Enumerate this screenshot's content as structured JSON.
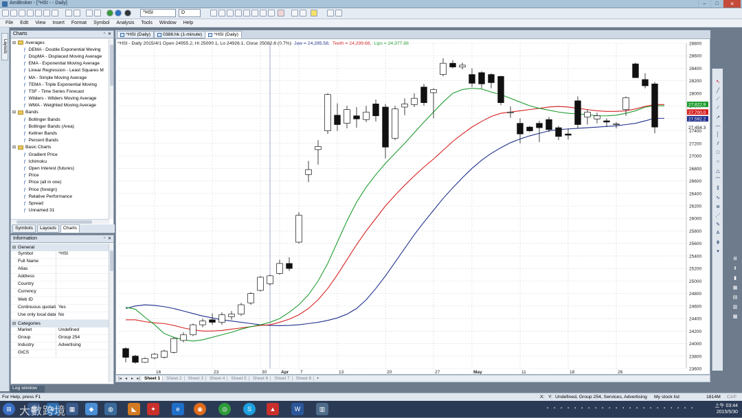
{
  "window": {
    "title": "AmiBroker - [^HSI - - Daily]",
    "min": "–",
    "max": "□",
    "close": "✕"
  },
  "toolbar": {
    "symbol": "^HSI",
    "interval": "D"
  },
  "menu": [
    "File",
    "Edit",
    "View",
    "Insert",
    "Format",
    "Symbol",
    "Analysis",
    "Tools",
    "Window",
    "Help"
  ],
  "left_tab": "Layouts",
  "charts_panel": {
    "title": "Charts",
    "tree": [
      {
        "kind": "folder",
        "label": "Averages"
      },
      {
        "kind": "item",
        "label": "DEMA - Double Exponential Moving"
      },
      {
        "kind": "item",
        "label": "DispMA - Displaced Moving Average"
      },
      {
        "kind": "item",
        "label": "EMA - Exponential Moving Average"
      },
      {
        "kind": "item",
        "label": "Linear Regression - Least Squares M"
      },
      {
        "kind": "item",
        "label": "MA - Simple Moving Average"
      },
      {
        "kind": "item",
        "label": "TEMA - Triple Exponential Moving"
      },
      {
        "kind": "item",
        "label": "TSF - Time Series Forecast"
      },
      {
        "kind": "item",
        "label": "Wilders - Wilders Moving Average"
      },
      {
        "kind": "item",
        "label": "WMA - Weighted Moving Average"
      },
      {
        "kind": "folder",
        "label": "Bands"
      },
      {
        "kind": "item",
        "label": "Bollinger Bands"
      },
      {
        "kind": "item",
        "label": "Bollinger Bands (Area)"
      },
      {
        "kind": "item",
        "label": "Keltner Bands"
      },
      {
        "kind": "item",
        "label": "Percent Bands"
      },
      {
        "kind": "folder",
        "label": "Basic Charts"
      },
      {
        "kind": "item",
        "label": "Gradient Price"
      },
      {
        "kind": "item",
        "label": "Ichimoku"
      },
      {
        "kind": "item",
        "label": "Open Interest (futures)"
      },
      {
        "kind": "item",
        "label": "Price"
      },
      {
        "kind": "item",
        "label": "Price (all in one)"
      },
      {
        "kind": "item",
        "label": "Price (foreign)"
      },
      {
        "kind": "item",
        "label": "Relative Performance"
      },
      {
        "kind": "item",
        "label": "Spread"
      },
      {
        "kind": "item",
        "label": "Unnamed 31"
      }
    ],
    "tabs": [
      "Symbols",
      "Layouts",
      "Charts"
    ],
    "active_tab": "Charts"
  },
  "info_panel": {
    "title": "Information",
    "sections": [
      {
        "name": "General",
        "rows": [
          {
            "k": "Symbol",
            "v": "^HSI"
          },
          {
            "k": "Full Name",
            "v": ""
          },
          {
            "k": "Alias",
            "v": ""
          },
          {
            "k": "Address",
            "v": ""
          },
          {
            "k": "Country",
            "v": ""
          },
          {
            "k": "Currency",
            "v": ""
          },
          {
            "k": "Web ID",
            "v": ""
          },
          {
            "k": "Continuous quotatio",
            "v": "Yes"
          },
          {
            "k": "Use only local datab",
            "v": "No"
          }
        ]
      },
      {
        "name": "Categories",
        "rows": [
          {
            "k": "Market",
            "v": "Undefined"
          },
          {
            "k": "Group",
            "v": "Group 254"
          },
          {
            "k": "Industry",
            "v": "Advertising"
          },
          {
            "k": "GICS",
            "v": ""
          }
        ]
      }
    ]
  },
  "doc_tabs": [
    "^HSI (Daily)",
    "0388.hk (1-minute)",
    "^HSI (Daily)"
  ],
  "active_doc_tab": 2,
  "chart_header": {
    "prefix": "^HSI - Daily 2015/4/1 Open 24955.2, Hi 25099.1, Lo 24926.1, Close 25082.8 (0.7%)",
    "jaw": "Jaw = 24,285.58,",
    "teeth": "Teeth = 24,299.68,",
    "lips": "Lips = 24,377.88"
  },
  "chart_data": {
    "type": "candlestick",
    "title": "^HSI - Daily",
    "ylim": [
      23600,
      28800
    ],
    "yticks": [
      23600,
      23800,
      24000,
      24200,
      24400,
      24600,
      24800,
      25000,
      25200,
      25400,
      25600,
      25800,
      26000,
      26200,
      26400,
      26600,
      26800,
      27000,
      27200,
      27400,
      27600,
      27800,
      28000,
      28200,
      28400,
      28600,
      28800
    ],
    "xlabels": [
      {
        "i": 3,
        "label": "16"
      },
      {
        "i": 9,
        "label": "23"
      },
      {
        "i": 14,
        "label": "30"
      },
      {
        "i": 16,
        "label": "Apr"
      },
      {
        "i": 18,
        "label": "7"
      },
      {
        "i": 22,
        "label": "13"
      },
      {
        "i": 27,
        "label": "20"
      },
      {
        "i": 32,
        "label": "27"
      },
      {
        "i": 36,
        "label": "May"
      },
      {
        "i": 41,
        "label": "11"
      },
      {
        "i": 46,
        "label": "18"
      },
      {
        "i": 51,
        "label": "26"
      }
    ],
    "ohlc": [
      [
        23920,
        23940,
        23700,
        23780
      ],
      [
        23800,
        23820,
        23680,
        23700
      ],
      [
        23700,
        23780,
        23690,
        23760
      ],
      [
        23770,
        23850,
        23750,
        23830
      ],
      [
        23780,
        23900,
        23760,
        23880
      ],
      [
        23860,
        24100,
        23840,
        24080
      ],
      [
        24050,
        24180,
        24020,
        24140
      ],
      [
        24140,
        24320,
        24120,
        24300
      ],
      [
        24300,
        24400,
        24260,
        24360
      ],
      [
        24380,
        24480,
        24300,
        24340
      ],
      [
        24340,
        24500,
        24300,
        24460
      ],
      [
        24430,
        24520,
        24380,
        24470
      ],
      [
        24470,
        24650,
        24440,
        24620
      ],
      [
        24650,
        24820,
        24620,
        24800
      ],
      [
        24850,
        25080,
        24830,
        25060
      ],
      [
        24955,
        25099,
        24926,
        25083
      ],
      [
        25120,
        25340,
        25100,
        25280
      ],
      [
        25280,
        25380,
        25160,
        25200
      ],
      [
        25620,
        26100,
        25600,
        26050
      ],
      [
        26700,
        26920,
        26580,
        26780
      ],
      [
        27100,
        27250,
        26860,
        27150
      ],
      [
        27400,
        28000,
        27350,
        27980
      ],
      [
        27650,
        27840,
        27400,
        27500
      ],
      [
        27520,
        27800,
        27440,
        27740
      ],
      [
        27640,
        27780,
        27450,
        27590
      ],
      [
        27580,
        27800,
        27540,
        27700
      ],
      [
        27830,
        27900,
        27550,
        27640
      ],
      [
        27780,
        27830,
        26960,
        27140
      ],
      [
        27280,
        27800,
        27250,
        27750
      ],
      [
        27780,
        27920,
        27650,
        27830
      ],
      [
        27820,
        28000,
        27780,
        27920
      ],
      [
        28100,
        28150,
        27800,
        27850
      ],
      [
        28010,
        28080,
        27600,
        28060
      ],
      [
        28300,
        28560,
        28270,
        28480
      ],
      [
        28480,
        28530,
        28400,
        28420
      ],
      [
        28420,
        28490,
        28380,
        28450
      ],
      [
        28300,
        28400,
        28100,
        28160
      ],
      [
        28330,
        28350,
        28080,
        28150
      ],
      [
        28300,
        28320,
        28080,
        28170
      ],
      [
        28270,
        28280,
        27810,
        27850
      ],
      [
        27690,
        27790,
        27610,
        27700
      ],
      [
        27520,
        27600,
        27200,
        27350
      ],
      [
        27460,
        27480,
        27380,
        27400
      ],
      [
        27520,
        27560,
        27220,
        27450
      ],
      [
        27580,
        27620,
        27380,
        27420
      ],
      [
        27450,
        27480,
        27250,
        27310
      ],
      [
        27350,
        27440,
        27260,
        27330
      ],
      [
        27880,
        27950,
        27440,
        27500
      ],
      [
        27620,
        27740,
        27500,
        27700
      ],
      [
        27590,
        27690,
        27520,
        27640
      ],
      [
        27560,
        27600,
        27460,
        27540
      ],
      [
        27500,
        27540,
        27440,
        27510
      ],
      [
        27740,
        27950,
        27640,
        27930
      ],
      [
        28470,
        28490,
        28260,
        28250
      ],
      [
        28220,
        28320,
        28080,
        28120
      ],
      [
        28150,
        28180,
        27360,
        27460
      ]
    ],
    "series": [
      {
        "name": "Jaw",
        "color": "#1f2f8c",
        "values": [
          24560,
          24600,
          24620,
          24610,
          24590,
          24560,
          24520,
          24480,
          24440,
          24410,
          24380,
          24360,
          24340,
          24320,
          24300,
          24290,
          24286,
          24290,
          24300,
          24320,
          24340,
          24370,
          24410,
          24470,
          24560,
          24700,
          24880,
          25080,
          25300,
          25520,
          25740,
          25940,
          26130,
          26320,
          26490,
          26650,
          26800,
          26930,
          27040,
          27130,
          27210,
          27270,
          27320,
          27360,
          27400,
          27420,
          27430,
          27440,
          27450,
          27460,
          27470,
          27480,
          27500,
          27520,
          27560,
          27600,
          27600
        ]
      },
      {
        "name": "Teeth",
        "color": "#d62020",
        "values": [
          24380,
          24380,
          24350,
          24330,
          24320,
          24290,
          24250,
          24220,
          24200,
          24200,
          24210,
          24230,
          24250,
          24270,
          24290,
          24300,
          24340,
          24390,
          24460,
          24560,
          24700,
          24880,
          25100,
          25340,
          25580,
          25800,
          26000,
          26200,
          26370,
          26530,
          26680,
          26820,
          26950,
          27090,
          27230,
          27350,
          27460,
          27550,
          27630,
          27680,
          27700,
          27720,
          27740,
          27760,
          27780,
          27790,
          27780,
          27760,
          27740,
          27720,
          27710,
          27710,
          27720,
          27750,
          27790,
          27820,
          27820
        ]
      },
      {
        "name": "Lips",
        "color": "#1e9c2e",
        "values": [
          24580,
          24550,
          24420,
          24300,
          24160,
          24100,
          24060,
          24040,
          24060,
          24100,
          24140,
          24180,
          24230,
          24270,
          24300,
          24340,
          24400,
          24500,
          24620,
          24780,
          25000,
          25280,
          25620,
          25960,
          26260,
          26500,
          26700,
          26880,
          27040,
          27200,
          27370,
          27540,
          27700,
          27860,
          28000,
          28060,
          28080,
          28070,
          28020,
          27980,
          27920,
          27860,
          27800,
          27760,
          27730,
          27700,
          27680,
          27670,
          27660,
          27640,
          27640,
          27650,
          27680,
          27720,
          27780,
          27800,
          27800
        ]
      }
    ],
    "value_labels": [
      {
        "text": "27,822.9",
        "value": 27822.9,
        "color": "#1e9c2e"
      },
      {
        "text": "27,700.0",
        "value": 27700,
        "color": "#d62020"
      },
      {
        "text": "27,592.2",
        "value": 27592.2,
        "color": "#1f2f8c"
      },
      {
        "text": "27,454.3",
        "value": 27454.3,
        "color": ""
      }
    ]
  },
  "sheets": [
    "Sheet 1",
    "Sheet 2",
    "Sheet 3",
    "Sheet 4",
    "Sheet 5",
    "Sheet 6",
    "Sheet 7",
    "Sheet 8"
  ],
  "log_window": "Log window",
  "status": {
    "left": "For Help, press F1",
    "x": "X:",
    "y": "Y:",
    "info": "Undefined, Group 254, Services, Advertising",
    "list": "My stock list",
    "mem": "1814M",
    "cap": "CAP"
  },
  "taskbar": {
    "time": "上午 03:44",
    "date": "2015/5/30"
  },
  "watermark": "大數跨境"
}
